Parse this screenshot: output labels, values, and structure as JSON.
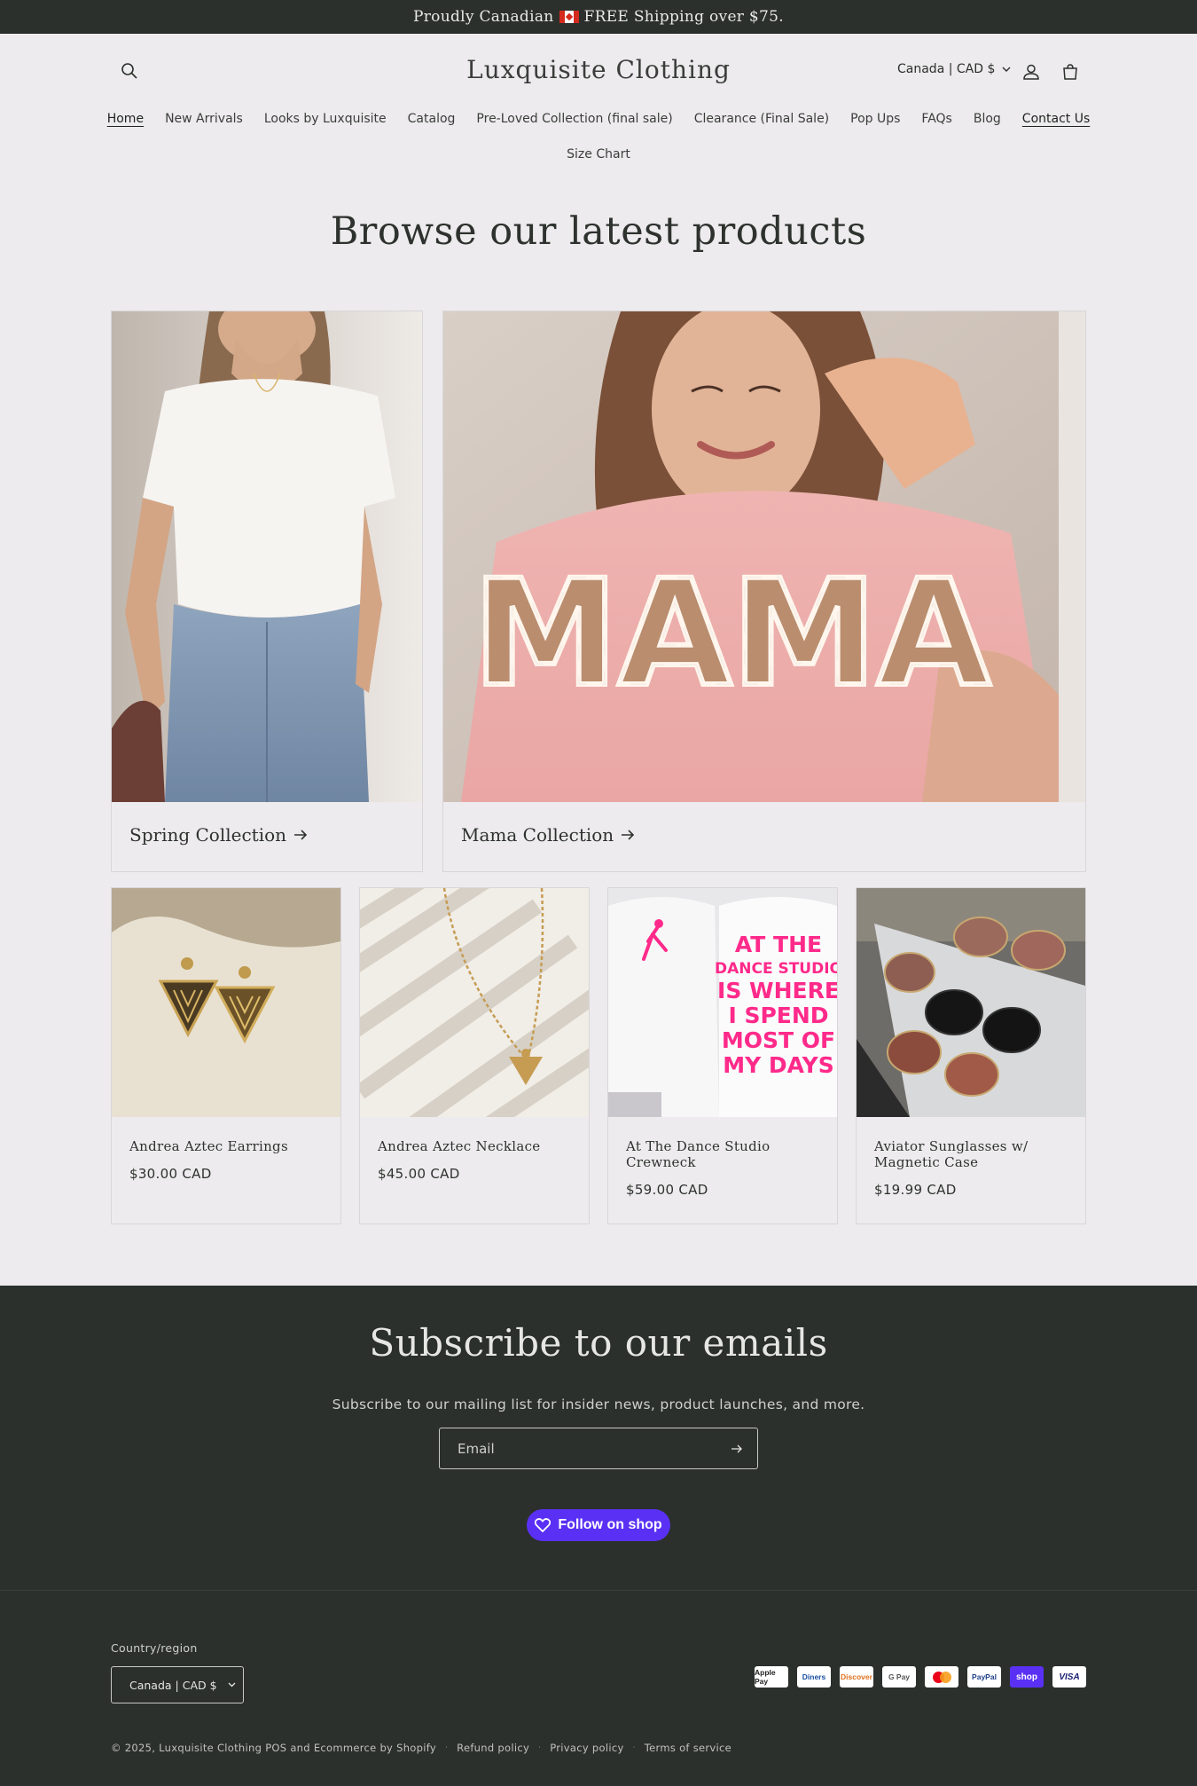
{
  "announcement": {
    "before_flag": "Proudly Canadian",
    "after_flag": "FREE Shipping over $75."
  },
  "header": {
    "logo": "Luxquisite Clothing",
    "currency": "Canada | CAD $"
  },
  "nav": {
    "row1": [
      "Home",
      "New Arrivals",
      "Looks by Luxquisite",
      "Catalog",
      "Pre-Loved Collection (final sale)",
      "Clearance (Final Sale)",
      "Pop Ups",
      "FAQs",
      "Blog",
      "Contact Us"
    ],
    "row2": [
      "Size Chart"
    ]
  },
  "main": {
    "title": "Browse our latest products",
    "collections": [
      {
        "label": "Spring Collection"
      },
      {
        "label": "Mama Collection"
      }
    ],
    "products": [
      {
        "name": "Andrea Aztec Earrings",
        "price": "$30.00 CAD"
      },
      {
        "name": "Andrea Aztec Necklace",
        "price": "$45.00 CAD"
      },
      {
        "name": "At The Dance Studio Crewneck",
        "price": "$59.00 CAD"
      },
      {
        "name": "Aviator Sunglasses w/ Magnetic Case",
        "price": "$19.99 CAD"
      }
    ],
    "mama_print": "MAMA",
    "crewneck_print": [
      "AT THE",
      "DANCE STUDIO",
      "IS WHERE",
      "I SPEND",
      "MOST OF",
      "MY DAYS"
    ]
  },
  "newsletter": {
    "title": "Subscribe to our emails",
    "text": "Subscribe to our mailing list for insider news, product launches, and more.",
    "email_placeholder": "Email",
    "follow_label": "Follow on shop"
  },
  "footer": {
    "country_label": "Country/region",
    "country_value": "Canada | CAD $",
    "payments": [
      "Apple Pay",
      "Diners",
      "Discover",
      "G Pay",
      "Mastercard",
      "PayPal",
      "shop",
      "VISA"
    ],
    "legal": {
      "copyright": "© 2025,",
      "store": "Luxquisite Clothing",
      "powered": "POS and Ecommerce by Shopify",
      "links": [
        "Refund policy",
        "Privacy policy",
        "Terms of service"
      ]
    }
  },
  "colors": {
    "accent": "#5a31f4",
    "dark_bg": "#2b302c",
    "page_bg": "#edebed"
  },
  "icons": [
    "search-icon",
    "account-icon",
    "cart-icon",
    "chevron-down-icon",
    "arrow-right-icon",
    "heart-icon"
  ]
}
